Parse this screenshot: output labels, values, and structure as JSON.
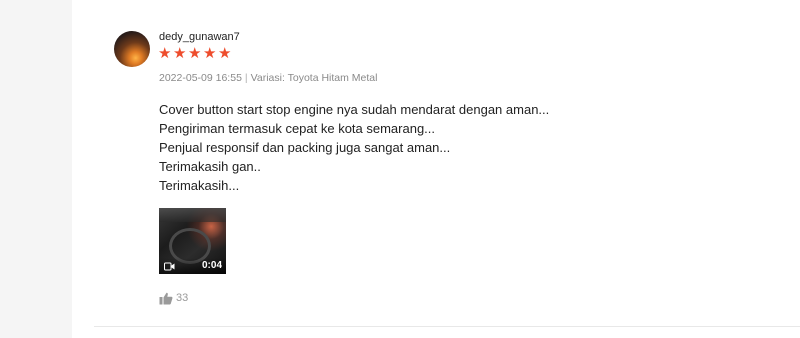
{
  "review": {
    "username": "dedy_gunawan7",
    "rating": 5,
    "stars": [
      "★",
      "★",
      "★",
      "★",
      "★"
    ],
    "date": "2022-05-09 16:55",
    "separator": "|",
    "variation": "Variasi: Toyota Hitam Metal",
    "text_lines": [
      "Cover button start stop engine nya sudah mendarat dengan aman...",
      "Pengiriman termasuk cepat ke kota semarang...",
      "Penjual responsif dan packing juga sangat aman...",
      "Terimakasih gan..",
      "Terimakasih..."
    ],
    "video": {
      "duration": "0:04",
      "icon": "video-camera-icon"
    },
    "likes": {
      "count": "33",
      "icon": "thumbs-up-icon"
    }
  },
  "colors": {
    "star": "#ee4d2d",
    "text": "#222222",
    "meta": "#8a8a8a",
    "background": "#f5f5f5",
    "panel": "#ffffff"
  }
}
